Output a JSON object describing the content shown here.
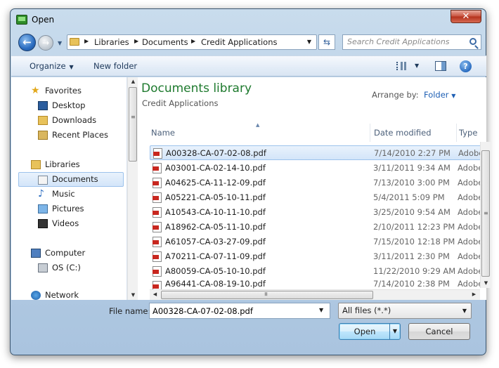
{
  "window": {
    "title": "Open"
  },
  "address": {
    "crumbs": [
      "Libraries",
      "Documents",
      "Credit Applications"
    ]
  },
  "search": {
    "placeholder": "Search Credit Applications"
  },
  "toolbar": {
    "organize": "Organize",
    "new_folder": "New folder"
  },
  "nav": {
    "items": [
      {
        "label": "Favorites",
        "icon": "star-icon"
      },
      {
        "label": "Desktop",
        "icon": "desktop-icon"
      },
      {
        "label": "Downloads",
        "icon": "downloads-folder-icon"
      },
      {
        "label": "Recent Places",
        "icon": "recent-places-icon"
      },
      {
        "label": "Libraries",
        "icon": "libraries-icon"
      },
      {
        "label": "Documents",
        "icon": "documents-icon"
      },
      {
        "label": "Music",
        "icon": "music-note-icon"
      },
      {
        "label": "Pictures",
        "icon": "pictures-icon"
      },
      {
        "label": "Videos",
        "icon": "film-icon"
      },
      {
        "label": "Computer",
        "icon": "computer-icon"
      },
      {
        "label": "OS (C:)",
        "icon": "drive-icon"
      },
      {
        "label": "Network",
        "icon": "network-icon"
      }
    ]
  },
  "library": {
    "title": "Documents library",
    "subtitle": "Credit Applications",
    "arrange_label": "Arrange by:",
    "arrange_value": "Folder"
  },
  "columns": {
    "name": "Name",
    "date": "Date modified",
    "type": "Type"
  },
  "files": [
    {
      "name": "A00328-CA-07-02-08.pdf",
      "date": "7/14/2010 2:27 PM",
      "type": "Adobe"
    },
    {
      "name": "A03001-CA-02-14-10.pdf",
      "date": "3/11/2011 9:34 AM",
      "type": "Adobe"
    },
    {
      "name": "A04625-CA-11-12-09.pdf",
      "date": "7/13/2010 3:00 PM",
      "type": "Adobe"
    },
    {
      "name": "A05221-CA-05-10-11.pdf",
      "date": "5/4/2011 5:09 PM",
      "type": "Adobe"
    },
    {
      "name": "A10543-CA-10-11-10.pdf",
      "date": "3/25/2010 9:54 AM",
      "type": "Adobe"
    },
    {
      "name": "A18962-CA-05-11-10.pdf",
      "date": "2/10/2011 12:23 PM",
      "type": "Adobe"
    },
    {
      "name": "A61057-CA-03-27-09.pdf",
      "date": "7/15/2010 12:18 PM",
      "type": "Adobe"
    },
    {
      "name": "A70211-CA-07-11-09.pdf",
      "date": "3/11/2011 2:30 PM",
      "type": "Adobe"
    },
    {
      "name": "A80059-CA-05-10-10.pdf",
      "date": "11/22/2010 9:29 AM",
      "type": "Adobe"
    },
    {
      "name": "A96441-CA-08-19-10.pdf",
      "date": "7/14/2010 2:38 PM",
      "type": "Adobe"
    }
  ],
  "footer": {
    "filename_label": "File name:",
    "filename_value": "A00328-CA-07-02-08.pdf",
    "filter": "All files (*.*)",
    "open": "Open",
    "cancel": "Cancel"
  }
}
